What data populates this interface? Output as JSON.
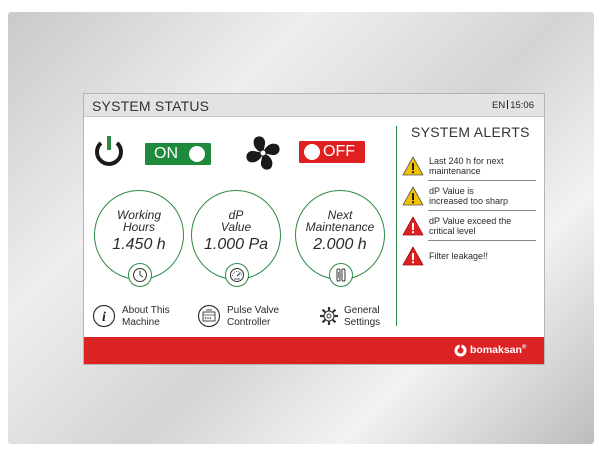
{
  "header": {
    "title": "SYSTEM STATUS",
    "language": "EN",
    "time": "15:06"
  },
  "power": {
    "icon": "power-icon",
    "toggle_label": "ON",
    "state": "on",
    "color": "#1e8a3c"
  },
  "fan": {
    "icon": "fan-icon",
    "toggle_label": "OFF",
    "state": "off",
    "color": "#e02020"
  },
  "gauges": [
    {
      "label_line1": "Working",
      "label_line2": "Hours",
      "value": "1.450 h",
      "icon": "clock-icon"
    },
    {
      "label_line1": "dP",
      "label_line2": "Value",
      "value": "1.000 Pa",
      "icon": "pressure-gauge-icon"
    },
    {
      "label_line1": "Next",
      "label_line2": "Maintenance",
      "value": "2.000 h",
      "icon": "wrench-screwdriver-icon"
    }
  ],
  "buttons": [
    {
      "line1": "About This",
      "line2": "Machine",
      "icon": "info-icon"
    },
    {
      "line1": "Pulse Valve",
      "line2": "Controller",
      "icon": "controller-icon"
    },
    {
      "line1": "General",
      "line2": "Settings",
      "icon": "gear-icon"
    }
  ],
  "alerts": {
    "title": "SYSTEM ALERTS",
    "items": [
      {
        "line1": "Last 240 h for next",
        "line2": "maintenance",
        "severity": "warning",
        "color": "#f2c200"
      },
      {
        "line1": "dP Value is",
        "line2": "increased too sharp",
        "severity": "warning",
        "color": "#f2c200"
      },
      {
        "line1": "dP Value exceed the",
        "line2": "critical level",
        "severity": "critical",
        "color": "#e02020"
      },
      {
        "line1": "Filter leakage!!",
        "line2": "",
        "severity": "critical",
        "color": "#e02020"
      }
    ]
  },
  "footer": {
    "brand": "bomaksan",
    "trademark": "®",
    "color": "#dc2323"
  },
  "colors": {
    "accent_green": "#2c8a44",
    "panel_bg": "#ffffff",
    "topbar_bg": "#e3e3e3"
  }
}
